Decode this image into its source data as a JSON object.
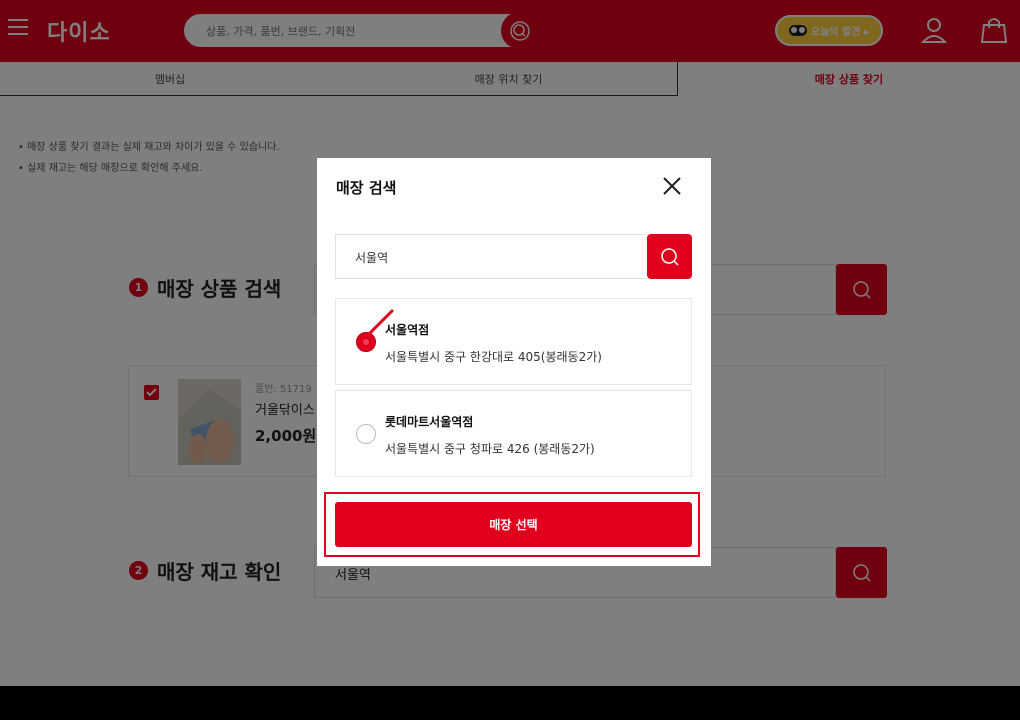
{
  "header": {
    "logo": "다이소",
    "search_placeholder": "상품, 가격, 품번, 브랜드, 기획전",
    "discovery_label": "오늘의 발견 ▸"
  },
  "tabs": [
    "멤버십",
    "매장 위치 찾기",
    "매장 상품 찾기"
  ],
  "notes": [
    "• 매장 상품 찾기 결과는 실제 재고와 차이가 있을 수 있습니다.",
    "• 실제 재고는 해당 매장으로 확인해 주세요."
  ],
  "section1": {
    "number": "1",
    "title": "매장 상품 검색"
  },
  "product": {
    "code": "품번: 51719",
    "name": "거울닦이스",
    "price": "2,000원"
  },
  "section2": {
    "number": "2",
    "title": "매장 재고 확인",
    "value": "서울역"
  },
  "modal": {
    "title": "매장 검색",
    "search_value": "서울역",
    "stores": [
      {
        "name": "서울역점",
        "address": "서울특별시 중구 한강대로 405(봉래동2가)",
        "selected": true
      },
      {
        "name": "롯데마트서울역점",
        "address": "서울특별시 중구 청파로 426 (봉래동2가)",
        "selected": false
      }
    ],
    "select_button": "매장 선택"
  },
  "colors": {
    "brand": "#e0001e",
    "dim": "rgba(0,0,0,0.5)"
  },
  "icons": [
    "menu-icon",
    "search-icon",
    "user-icon",
    "shopping-bag-icon",
    "close-icon",
    "checkmark-icon"
  ]
}
